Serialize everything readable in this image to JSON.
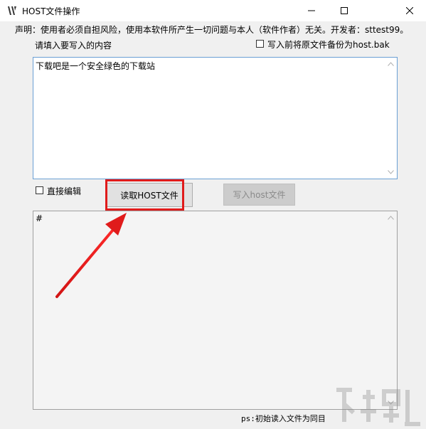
{
  "window": {
    "title": "HOST文件操作",
    "icon": "app-logo-icon",
    "controls": [
      "minimize-icon",
      "maximize-icon",
      "close-icon"
    ]
  },
  "disclaimer": "声明：使用者必须自担风险，使用本软件所产生一切问题与本人（软件作者）无关。开发者：sttest99。",
  "input_section": {
    "label": "请填入要写入的内容",
    "backup_checkbox_label": "写入前将原文件备份为host.bak",
    "backup_checked": false,
    "content": "下载吧是一个安全绿色的下载站"
  },
  "controls": {
    "direct_edit_label": "直接编辑",
    "direct_edit_checked": false,
    "read_button": "读取HOST文件",
    "write_button": "写入host文件"
  },
  "output_section": {
    "content": "#"
  },
  "status_text": "ps:初始读入文件为同目",
  "colors": {
    "highlight_border": "#e01b1b",
    "arrow": "#e01b1b",
    "input_border": "#6a9fd4"
  }
}
